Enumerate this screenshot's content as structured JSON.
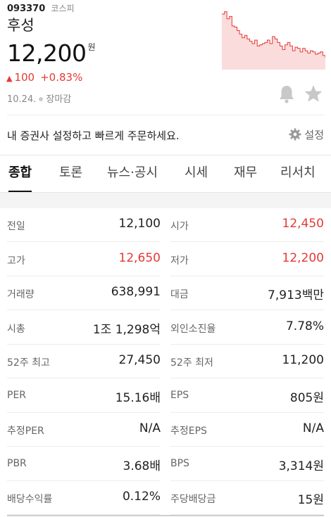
{
  "stock": {
    "code": "093370",
    "market": "코스피",
    "name": "후성",
    "price": "12,200",
    "price_unit": "원",
    "change_arrow": "▲",
    "change": "100",
    "change_pct": "+0.83%",
    "date": "10.24.",
    "status": "장마감"
  },
  "colors": {
    "up": "#e53935",
    "spark_line": "#e53935",
    "spark_fill": "#fbdcdc"
  },
  "sparkline": [
    0.94,
    0.98,
    0.86,
    0.9,
    0.74,
    0.72,
    0.66,
    0.6,
    0.54,
    0.58,
    0.52,
    0.48,
    0.44,
    0.5,
    0.4,
    0.42,
    0.44,
    0.46,
    0.5,
    0.44,
    0.56,
    0.52,
    0.46,
    0.4,
    0.34,
    0.42,
    0.46,
    0.4,
    0.32,
    0.38,
    0.36,
    0.3,
    0.36,
    0.32,
    0.28,
    0.32,
    0.3,
    0.26,
    0.28,
    0.3,
    0.24,
    0.2
  ],
  "banner": {
    "text": "내 증권사 설정하고 빠르게 주문하세요.",
    "settings_label": "설정"
  },
  "icons": {
    "bell": "bell-icon",
    "star": "star-icon",
    "gear": "gear-icon"
  },
  "tabs": [
    {
      "label": "종합",
      "active": true
    },
    {
      "label": "토론"
    },
    {
      "label": "뉴스·공시"
    },
    {
      "label": "시세"
    },
    {
      "label": "재무"
    },
    {
      "label": "리서치"
    }
  ],
  "rows": [
    {
      "left_label": "전일",
      "left_value": "12,100",
      "right_label": "시가",
      "right_value": "12,450",
      "right_red": true
    },
    {
      "left_label": "고가",
      "left_value": "12,650",
      "left_red": true,
      "right_label": "저가",
      "right_value": "12,200",
      "right_red": true
    },
    {
      "left_label": "거래량",
      "left_value": "638,991",
      "right_label": "대금",
      "right_value": "7,913백만"
    },
    {
      "left_label": "시총",
      "left_value": "1조 1,298억",
      "right_label": "외인소진율",
      "right_value": "7.78%"
    },
    {
      "left_label": "52주 최고",
      "left_value": "27,450",
      "right_label": "52주 최저",
      "right_value": "11,200"
    },
    {
      "left_label": "PER",
      "left_value": "15.16배",
      "right_label": "EPS",
      "right_value": "805원"
    },
    {
      "left_label": "추정PER",
      "left_value": "N/A",
      "right_label": "추정EPS",
      "right_value": "N/A"
    },
    {
      "left_label": "PBR",
      "left_value": "3.68배",
      "right_label": "BPS",
      "right_value": "3,314원"
    },
    {
      "left_label": "배당수익률",
      "left_value": "0.12%",
      "right_label": "주당배당금",
      "right_value": "15원"
    }
  ]
}
